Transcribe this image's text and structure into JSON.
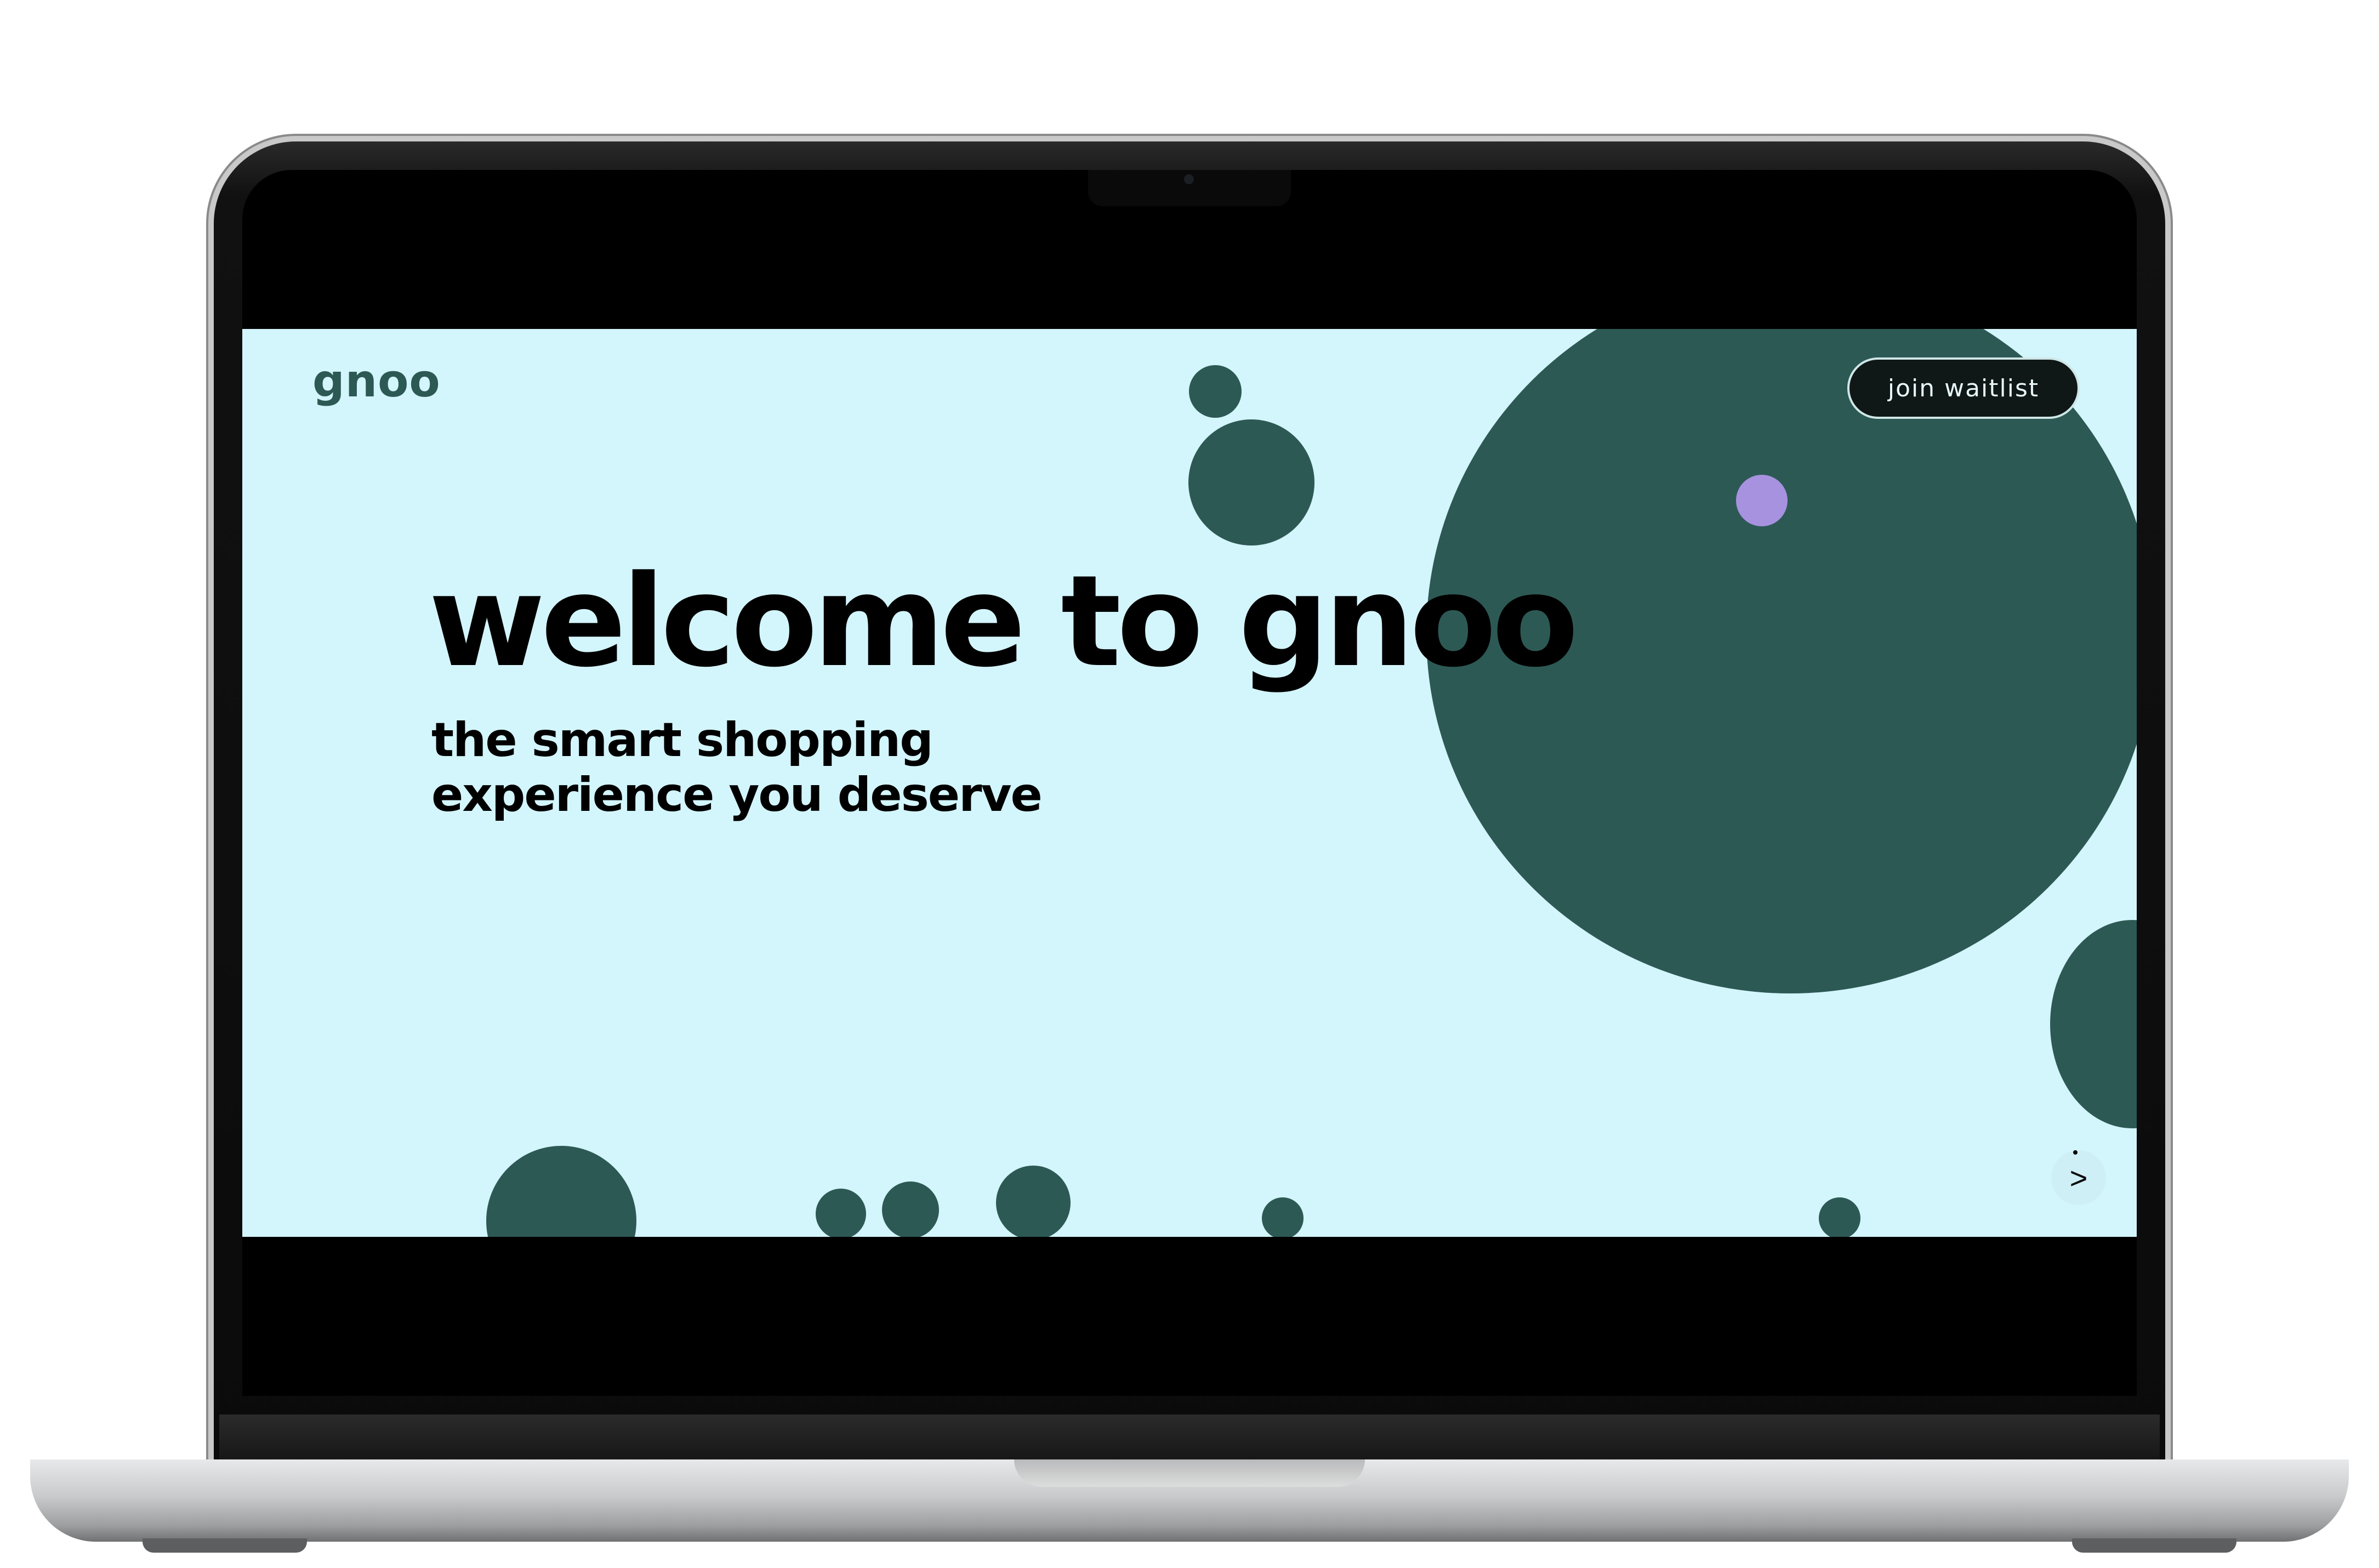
{
  "site": {
    "logo_text": "gnoo",
    "cta_label": "join waitlist",
    "headline": "welcome to gnoo",
    "subheadline_line1": "the smart shopping",
    "subheadline_line2": "experience you deserve",
    "next_icon": ">"
  },
  "colors": {
    "background": "#d3f5fc",
    "accent_dark_green": "#2d5955",
    "accent_lavender": "#a792e0",
    "button_bg": "#0f1717"
  }
}
